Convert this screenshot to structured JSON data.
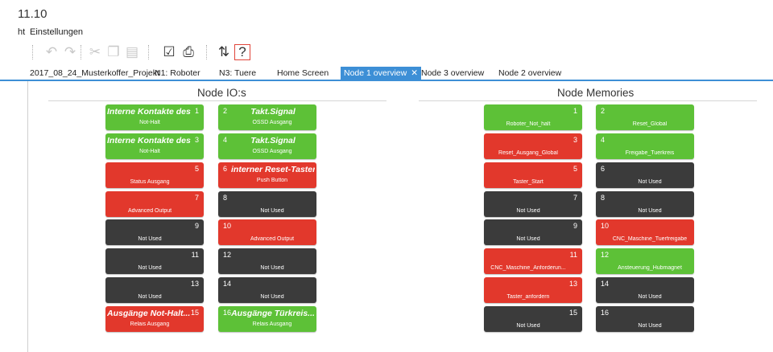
{
  "app": {
    "title": "11.10"
  },
  "menu": {
    "items": [
      "ht",
      "Einstellungen"
    ]
  },
  "toolbar": {
    "icons": [
      "undo-icon",
      "redo-icon",
      "cut-icon",
      "copy-icon",
      "paste-icon",
      "checkbox-icon",
      "print-icon",
      "transfer-icon",
      "help-icon"
    ]
  },
  "tabs": [
    {
      "label": "2017_08_24_Musterkoffer_Projekt",
      "active": false
    },
    {
      "label": "N1: Roboter",
      "active": false
    },
    {
      "label": "N3: Tuere",
      "active": false
    },
    {
      "label": "Home Screen",
      "active": false
    },
    {
      "label": "Node 1 overview",
      "active": true,
      "close": "✕"
    },
    {
      "label": "Node 3 overview",
      "active": false
    },
    {
      "label": "Node 2 overview",
      "active": false
    }
  ],
  "io": {
    "title": "Node IO:s",
    "tiles": [
      {
        "num": "1",
        "name": "Interne Kontakte des...",
        "sub": "Not-Halt",
        "color": "green"
      },
      {
        "num": "2",
        "name": "Takt.Signal",
        "sub": "OSSD Ausgang",
        "color": "green"
      },
      {
        "num": "3",
        "name": "Interne Kontakte des...",
        "sub": "Not-Halt",
        "color": "green"
      },
      {
        "num": "4",
        "name": "Takt.Signal",
        "sub": "OSSD Ausgang",
        "color": "green"
      },
      {
        "num": "5",
        "name": "",
        "sub": "Status Ausgang",
        "color": "red"
      },
      {
        "num": "6",
        "name": "interner Reset-Taster...",
        "sub": "Push Button",
        "color": "red"
      },
      {
        "num": "7",
        "name": "",
        "sub": "Advanced Output",
        "color": "red"
      },
      {
        "num": "8",
        "name": "",
        "sub": "Not Used",
        "color": "dark"
      },
      {
        "num": "9",
        "name": "",
        "sub": "Not Used",
        "color": "dark"
      },
      {
        "num": "10",
        "name": "",
        "sub": "Advanced Output",
        "color": "red"
      },
      {
        "num": "11",
        "name": "",
        "sub": "Not Used",
        "color": "dark"
      },
      {
        "num": "12",
        "name": "",
        "sub": "Not Used",
        "color": "dark"
      },
      {
        "num": "13",
        "name": "",
        "sub": "Not Used",
        "color": "dark"
      },
      {
        "num": "14",
        "name": "",
        "sub": "Not Used",
        "color": "dark"
      },
      {
        "num": "15",
        "name": "Ausgänge Not-Halt...",
        "sub": "Relais Ausgang",
        "color": "red"
      },
      {
        "num": "16",
        "name": "Ausgänge Türkreis...",
        "sub": "Relais Ausgang",
        "color": "green"
      }
    ]
  },
  "memories": {
    "title": "Node Memories",
    "tiles": [
      {
        "num": "1",
        "name": "",
        "sub": "Roboter_Not_halt",
        "color": "green"
      },
      {
        "num": "2",
        "name": "",
        "sub": "Reset_Global",
        "color": "green"
      },
      {
        "num": "3",
        "name": "",
        "sub": "Reset_Ausgang_Global",
        "color": "red"
      },
      {
        "num": "4",
        "name": "",
        "sub": "Freigabe_Tuerkreis",
        "color": "green"
      },
      {
        "num": "5",
        "name": "",
        "sub": "Taster_Start",
        "color": "red"
      },
      {
        "num": "6",
        "name": "",
        "sub": "Not Used",
        "color": "dark"
      },
      {
        "num": "7",
        "name": "",
        "sub": "Not Used",
        "color": "dark"
      },
      {
        "num": "8",
        "name": "",
        "sub": "Not Used",
        "color": "dark"
      },
      {
        "num": "9",
        "name": "",
        "sub": "Not Used",
        "color": "dark"
      },
      {
        "num": "10",
        "name": "",
        "sub": "CNC_Maschine_Tuerfreigabe",
        "color": "red"
      },
      {
        "num": "11",
        "name": "",
        "sub": "CNC_Maschine_Anforderun...",
        "color": "red"
      },
      {
        "num": "12",
        "name": "",
        "sub": "Ansteuerung_Hubmagnet",
        "color": "green"
      },
      {
        "num": "13",
        "name": "",
        "sub": "Taster_anfordern",
        "color": "red"
      },
      {
        "num": "14",
        "name": "",
        "sub": "Not Used",
        "color": "dark"
      },
      {
        "num": "15",
        "name": "",
        "sub": "Not Used",
        "color": "dark"
      },
      {
        "num": "16",
        "name": "",
        "sub": "Not Used",
        "color": "dark"
      }
    ]
  },
  "colors": {
    "green": "#5dc137",
    "red": "#e2382c",
    "dark": "#3b3b3b",
    "tab_active": "#3d8fd6"
  }
}
